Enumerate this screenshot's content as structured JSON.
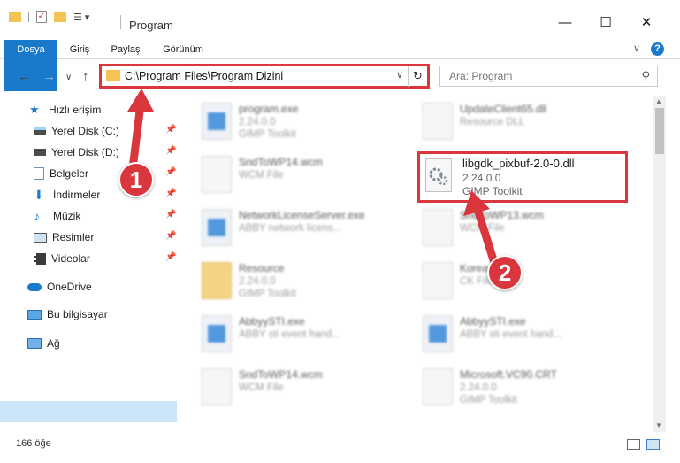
{
  "window": {
    "title": "Program",
    "minimize": "—",
    "maximize": "☐",
    "close": "✕"
  },
  "ribbon": {
    "tabs": [
      "Dosya",
      "Giriş",
      "Paylaş",
      "Görünüm"
    ],
    "expand": "∨",
    "help": "?"
  },
  "nav": {
    "back": "←",
    "forward": "→",
    "recent": "∨",
    "up": "↑",
    "address": "C:\\Program Files\\Program Dizini",
    "address_dropdown": "∨",
    "refresh": "↻",
    "search_placeholder": "Ara: Program",
    "search_icon": "⚲"
  },
  "sidebar": {
    "items": [
      {
        "label": "Hızlı erişim",
        "icon": "star-icon"
      },
      {
        "label": "Yerel Disk (C:)",
        "icon": "drive-icon",
        "pinned": true
      },
      {
        "label": "Yerel Disk (D:)",
        "icon": "drive-icon",
        "pinned": true
      },
      {
        "label": "Belgeler",
        "icon": "documents-icon",
        "pinned": true
      },
      {
        "label": "İndirmeler",
        "icon": "download-icon",
        "pinned": true
      },
      {
        "label": "Müzik",
        "icon": "music-icon",
        "pinned": true
      },
      {
        "label": "Resimler",
        "icon": "pictures-icon",
        "pinned": true
      },
      {
        "label": "Videolar",
        "icon": "videos-icon",
        "pinned": true
      },
      {
        "label": "OneDrive",
        "icon": "cloud-icon"
      },
      {
        "label": "Bu bilgisayar",
        "icon": "computer-icon",
        "selected": true
      },
      {
        "label": "Ağ",
        "icon": "network-icon"
      }
    ]
  },
  "files": [
    {
      "name": "program.exe",
      "line1": "2.24.0.0",
      "line2": "GIMP Toolkit",
      "kind": "exe"
    },
    {
      "name": "UpdateClient65.dll",
      "line1": "Resource DLL",
      "line2": "",
      "kind": "dll"
    },
    {
      "name": "SndToWP14.wcm",
      "line1": "WCM File",
      "line2": "",
      "kind": "doc"
    },
    {
      "name": "libgdk_pixbuf-2.0-0.dll",
      "line1": "2.24.0.0",
      "line2": "GIMP Toolkit",
      "kind": "dll",
      "highlighted": true
    },
    {
      "name": "NetworkLicenseServer.exe",
      "line1": "ABBY network licens...",
      "line2": "",
      "kind": "app"
    },
    {
      "name": "SndToWP13.wcm",
      "line1": "WCM File",
      "line2": "",
      "kind": "doc"
    },
    {
      "name": "Resource",
      "line1": "2.24.0.0",
      "line2": "GIMP Toolkit",
      "kind": "folder"
    },
    {
      "name": "Korean",
      "line1": "CK File",
      "line2": "",
      "kind": "doc"
    },
    {
      "name": "AbbyySTI.exe",
      "line1": "ABBY sti event hand...",
      "line2": "",
      "kind": "app"
    },
    {
      "name": "AbbyySTI.exe",
      "line1": "ABBY sti event hand...",
      "line2": "",
      "kind": "app"
    },
    {
      "name": "SndToWP14.wcm",
      "line1": "WCM File",
      "line2": "",
      "kind": "doc"
    },
    {
      "name": "Microsoft.VC90.CRT",
      "line1": "2.24.0.0",
      "line2": "GIMP Toolkit",
      "kind": "doc"
    }
  ],
  "status": {
    "count": "166 öğe"
  },
  "callouts": {
    "one": "1",
    "two": "2"
  },
  "colors": {
    "accent": "#1979ca",
    "highlight": "#d9363e",
    "selected": "#cce4f7"
  }
}
